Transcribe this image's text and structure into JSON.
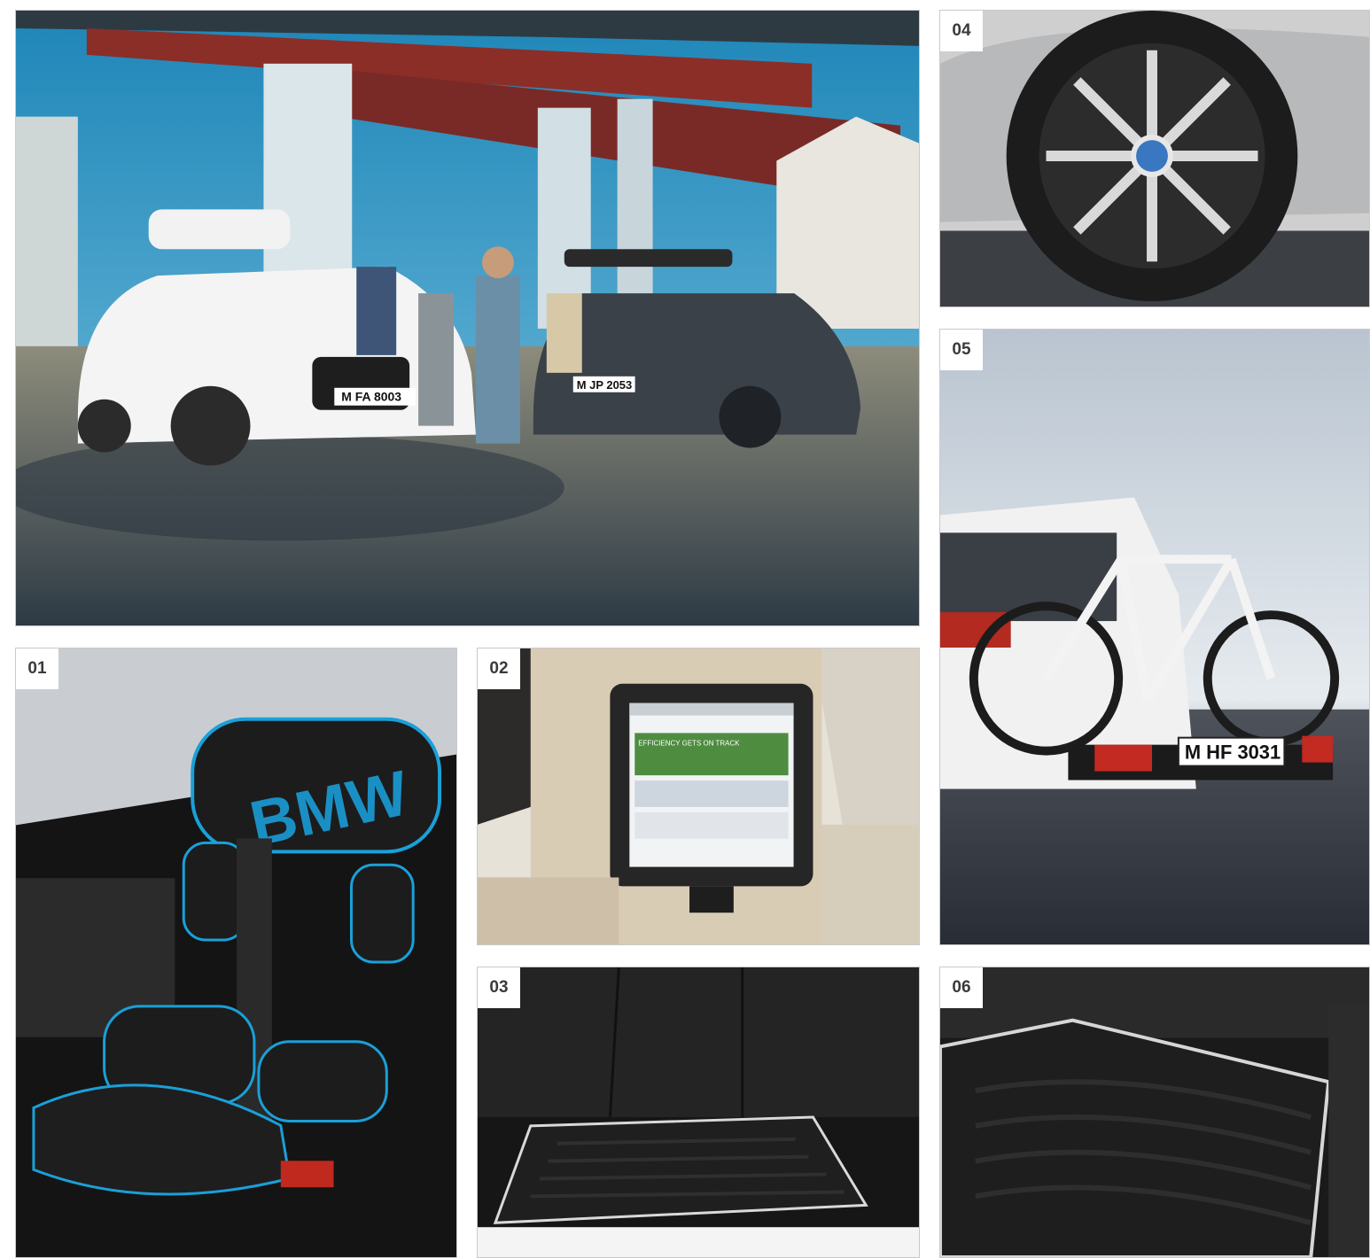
{
  "tiles": [
    {
      "id": "hero",
      "label": ""
    },
    {
      "id": "01",
      "label": "01",
      "seat_logo": "BMW"
    },
    {
      "id": "02",
      "label": "02",
      "screen_headline": "EFFICIENCY GETS ON TRACK"
    },
    {
      "id": "03",
      "label": "03"
    },
    {
      "id": "04",
      "label": "04"
    },
    {
      "id": "05",
      "label": "05",
      "plate": "M HF 3031"
    },
    {
      "id": "06",
      "label": "06"
    }
  ],
  "hero": {
    "plate_white_car": "M FA 8003",
    "plate_dark_car": "M JP 2053"
  }
}
